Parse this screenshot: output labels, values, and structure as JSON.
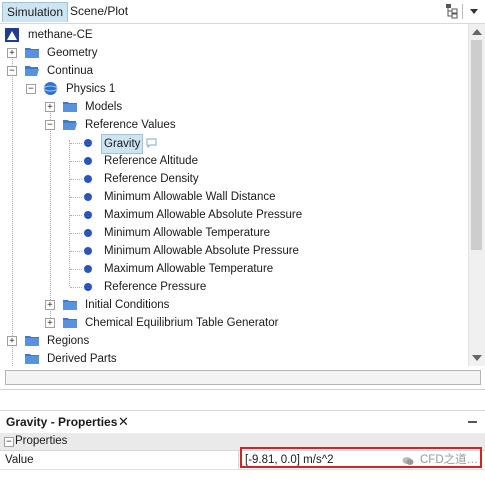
{
  "tabs": {
    "simulation": "Simulation",
    "scene_plot": "Scene/Plot"
  },
  "tree": {
    "root": "methane-CE",
    "geometry": "Geometry",
    "continua": "Continua",
    "physics": "Physics 1",
    "models": "Models",
    "reference_values": "Reference Values",
    "reference_items": [
      "Gravity",
      "Reference Altitude",
      "Reference Density",
      "Minimum Allowable Wall Distance",
      "Maximum Allowable Absolute Pressure",
      "Minimum Allowable Temperature",
      "Minimum Allowable Absolute Pressure",
      "Maximum Allowable Temperature",
      "Reference Pressure"
    ],
    "initial_conditions": "Initial Conditions",
    "chemical_equilibrium": "Chemical Equilibrium Table Generator",
    "regions": "Regions",
    "derived_parts": "Derived Parts"
  },
  "properties": {
    "title": "Gravity - Properties",
    "close_glyph": "✕",
    "section": "Properties",
    "name": "Value",
    "value": "[-9.81, 0.0] m/s^2",
    "watermark": "CFD之道…"
  },
  "colors": {
    "accent": "#cde4f3",
    "highlight_border": "#d1232a",
    "folder": "#3d78c9"
  }
}
